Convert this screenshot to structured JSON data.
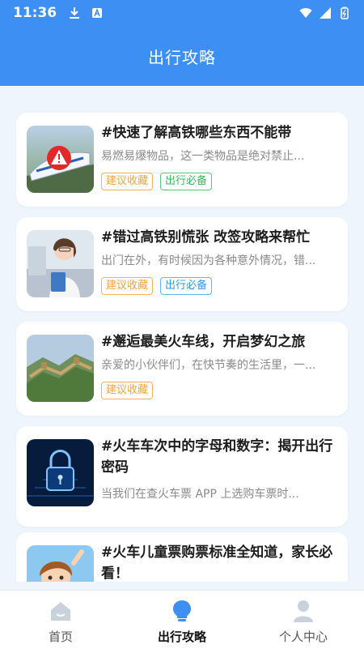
{
  "status_bar": {
    "time": "11:36"
  },
  "header": {
    "title": "出行攻略"
  },
  "articles": [
    {
      "title": "#快速了解高铁哪些东西不能带",
      "desc": "易燃易爆物品，这一类物品是绝对禁止...",
      "tags": [
        "建议收藏",
        "出行必备"
      ],
      "thumb_icon": "high-speed-train-warning"
    },
    {
      "title": "#错过高铁别慌张 改签攻略来帮忙",
      "desc": "出门在外，有时候因为各种意外情况，错...",
      "tags": [
        "建议收藏",
        "出行必备"
      ],
      "thumb_icon": "woman-at-station"
    },
    {
      "title": "#邂逅最美火车线，开启梦幻之旅",
      "desc": "亲爱的小伙伴们，在快节奏的生活里，一...",
      "tags": [
        "建议收藏"
      ],
      "thumb_icon": "great-wall"
    },
    {
      "title": "#火车车次中的字母和数字：揭开出行密码",
      "desc": "当我们在查火车票 APP 上选购车票时...",
      "tags": [],
      "thumb_icon": "digital-lock"
    },
    {
      "title": "#火车儿童票购票标准全知道，家长必看！",
      "desc": "",
      "tags": [],
      "thumb_icon": "cartoon-child"
    }
  ],
  "bottom_nav": [
    {
      "label": "首页",
      "icon": "home-icon"
    },
    {
      "label": "出行攻略",
      "icon": "bulb-icon"
    },
    {
      "label": "个人中心",
      "icon": "person-icon"
    }
  ],
  "colors": {
    "primary": "#3d8ff4",
    "background": "#eef5fd",
    "tag_orange": "#f2a33a",
    "tag_green": "#3bb55b",
    "tag_blue": "#2b9bf0"
  }
}
